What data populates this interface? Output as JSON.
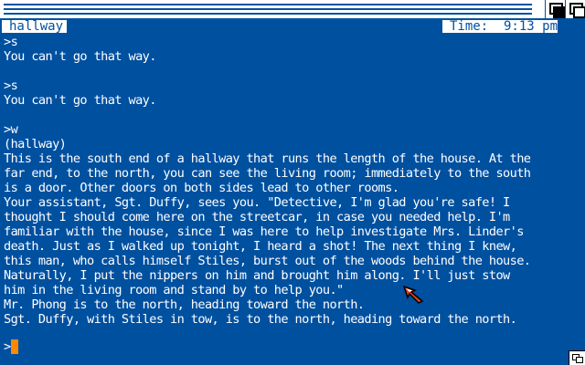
{
  "status": {
    "room": "hallway",
    "time": "Time:  9:13 pm"
  },
  "transcript": [
    ">s",
    "You can't go that way.",
    "",
    ">s",
    "You can't go that way.",
    "",
    ">w",
    "(hallway)",
    "This is the south end of a hallway that runs the length of the house. At the",
    "far end, to the north, you can see the living room; immediately to the south",
    "is a door. Other doors on both sides lead to other rooms.",
    "Your assistant, Sgt. Duffy, sees you. \"Detective, I'm glad you're safe! I",
    "thought I should come here on the streetcar, in case you needed help. I'm",
    "familiar with the house, since I was here to help investigate Mrs. Linder's",
    "death. Just as I walked up tonight, I heard a shot! The next thing I knew,",
    "this man, who calls himself Stiles, burst out of the woods behind the house.",
    "Naturally, I put the nippers on him and brought him along. I'll just stow",
    "him in the living room and stand by to help you.\"",
    "Mr. Phong is to the north, heading toward the north.",
    "Sgt. Duffy, with Stiles in tow, is to the north, heading toward the north."
  ],
  "prompt": {
    "symbol": ">",
    "input_value": ""
  },
  "icons": {
    "depth_back": "window-back-icon",
    "depth_front": "window-front-icon",
    "resize": "resize-gadget-icon",
    "pointer": "mouse-pointer-icon"
  },
  "colors": {
    "background": "#0050a0",
    "text": "#ffffff",
    "cursor": "#ff8800",
    "pointer": "#e04020"
  }
}
